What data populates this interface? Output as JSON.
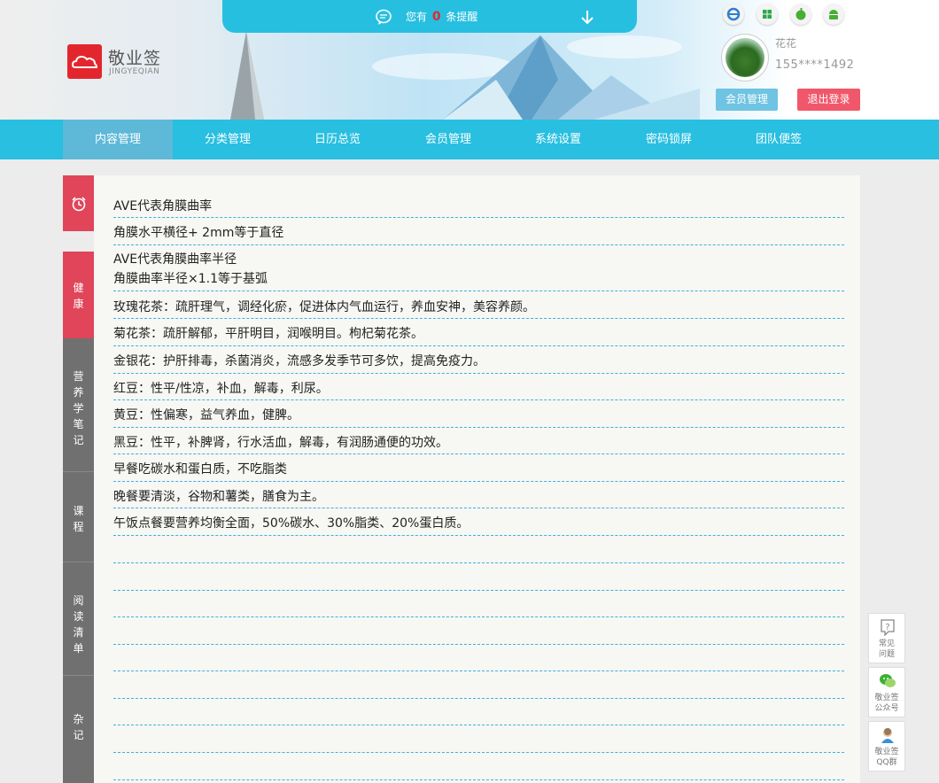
{
  "logo": {
    "title": "敬业签",
    "subtitle": "JINGYEQIAN",
    "icon": "cloud-logo-icon"
  },
  "reminder": {
    "prefix": "您有",
    "count": "0",
    "suffix": "条提醒",
    "icon": "chat-bubble-icon",
    "arrow_icon": "arrow-down-icon"
  },
  "platforms": [
    "ie-icon",
    "windows-icon",
    "apple-icon",
    "android-icon"
  ],
  "user": {
    "name": "花花",
    "phone": "155****1492",
    "member_button": "会员管理",
    "logout_button": "退出登录"
  },
  "nav": {
    "items": [
      {
        "label": "内容管理",
        "active": true
      },
      {
        "label": "分类管理"
      },
      {
        "label": "日历总览"
      },
      {
        "label": "会员管理"
      },
      {
        "label": "系统设置"
      },
      {
        "label": "密码锁屏"
      },
      {
        "label": "团队便签"
      }
    ]
  },
  "sidebar": {
    "alarm_icon": "alarm-clock-icon",
    "tabs": [
      {
        "label": "健康",
        "color": "#e0455a"
      },
      {
        "label": "营养学笔记",
        "color": "#707070"
      },
      {
        "label": "课程",
        "color": "#707070"
      },
      {
        "label": "阅读清单",
        "color": "#707070"
      },
      {
        "label": "杂记",
        "color": "#707070"
      }
    ]
  },
  "notes": [
    {
      "lines": [
        "AVE代表角膜曲率"
      ]
    },
    {
      "lines": [
        "角膜水平横径+ 2mm等于直径"
      ]
    },
    {
      "lines": [
        "AVE代表角膜曲率半径",
        "角膜曲率半径×1.1等于基弧"
      ]
    },
    {
      "lines": [
        "玫瑰花茶：疏肝理气，调经化瘀，促进体内气血运行，养血安神，美容养颜。"
      ]
    },
    {
      "lines": [
        "菊花茶：疏肝解郁，平肝明目，润喉明目。枸杞菊花茶。"
      ]
    },
    {
      "lines": [
        "金银花：护肝排毒，杀菌消炎，流感多发季节可多饮，提高免疫力。"
      ]
    },
    {
      "lines": [
        "红豆：性平/性凉，补血，解毒，利尿。"
      ]
    },
    {
      "lines": [
        "黄豆：性偏寒，益气养血，健脾。"
      ]
    },
    {
      "lines": [
        "黑豆：性平，补脾肾，行水活血，解毒，有润肠通便的功效。"
      ]
    },
    {
      "lines": [
        "早餐吃碳水和蛋白质，不吃脂类"
      ]
    },
    {
      "lines": [
        "晚餐要清淡，谷物和薯类，膳食为主。"
      ]
    },
    {
      "lines": [
        "午饭点餐要营养均衡全面，50%碳水、30%脂类、20%蛋白质。"
      ]
    }
  ],
  "float": [
    {
      "label_1": "常见",
      "label_2": "问题",
      "icon": "question-icon"
    },
    {
      "label_1": "敬业签",
      "label_2": "公众号",
      "icon": "wechat-icon"
    },
    {
      "label_1": "敬业签",
      "label_2": "QQ群",
      "icon": "qq-icon"
    }
  ]
}
